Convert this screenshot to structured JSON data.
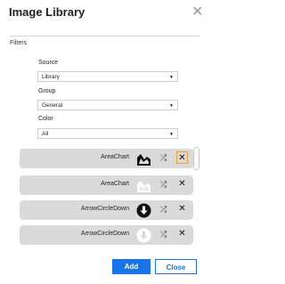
{
  "dialog": {
    "title": "Image Library",
    "close_icon": "close-icon"
  },
  "filters": {
    "label": "Filters",
    "source": {
      "label": "Source",
      "value": "Library"
    },
    "group": {
      "label": "Group",
      "value": "General"
    },
    "color": {
      "label": "Color",
      "value": "All"
    }
  },
  "images": [
    {
      "name": "AreaChart",
      "icon": "area-chart-icon",
      "variant": "dark"
    },
    {
      "name": "AreaChart",
      "icon": "area-chart-icon",
      "variant": "light"
    },
    {
      "name": "ArrowCircleDown",
      "icon": "arrow-circle-down-icon",
      "variant": "dark"
    },
    {
      "name": "ArrowCircleDown",
      "icon": "arrow-circle-down-icon",
      "variant": "light"
    }
  ],
  "row_actions": {
    "shuffle_icon": "shuffle-icon",
    "remove_icon": "remove-icon"
  },
  "buttons": {
    "add": "Add",
    "close": "Close"
  },
  "colors": {
    "accent": "#1a73e8",
    "focus": "#f0a030",
    "row_bg": "#dadada"
  }
}
